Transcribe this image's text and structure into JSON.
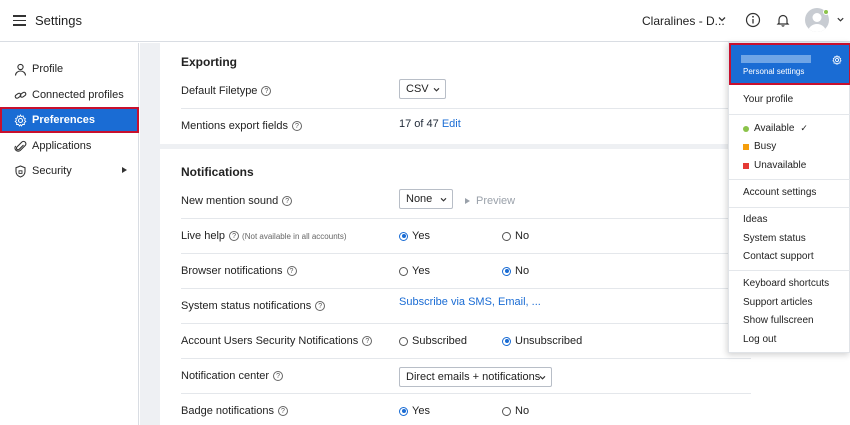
{
  "header": {
    "app_title": "Settings",
    "account_name": "Claralines - D..."
  },
  "sidebar": {
    "items": [
      {
        "label": "Profile",
        "icon": "person-icon"
      },
      {
        "label": "Connected profiles",
        "icon": "link-icon"
      },
      {
        "label": "Preferences",
        "icon": "gear-icon",
        "active": true
      },
      {
        "label": "Applications",
        "icon": "paperclip-icon"
      },
      {
        "label": "Security",
        "icon": "shield-icon",
        "has_submenu": true
      }
    ]
  },
  "exporting": {
    "title": "Exporting",
    "default_filetype_label": "Default Filetype",
    "default_filetype_value": "CSV",
    "mentions_export_label": "Mentions export fields",
    "mentions_export_count": "17 of 47",
    "mentions_export_edit": "Edit"
  },
  "notifications": {
    "title": "Notifications",
    "new_mention_sound_label": "New mention sound",
    "new_mention_sound_value": "None",
    "preview_label": "Preview",
    "live_help_label": "Live help",
    "live_help_note": "(Not available in all accounts)",
    "browser_notifications_label": "Browser notifications",
    "system_status_label": "System status notifications",
    "system_status_link": "Subscribe via SMS, Email, ...",
    "security_notifications_label": "Account Users Security Notifications",
    "subscribed_label": "Subscribed",
    "unsubscribed_label": "Unsubscribed",
    "notification_center_label": "Notification center",
    "notification_center_value": "Direct emails + notifications",
    "badge_notifications_label": "Badge notifications",
    "yes_label": "Yes",
    "no_label": "No"
  },
  "menu": {
    "personal_settings": "Personal settings",
    "your_profile": "Your profile",
    "available": "Available",
    "busy": "Busy",
    "unavailable": "Unavailable",
    "account_settings": "Account settings",
    "ideas": "Ideas",
    "system_status": "System status",
    "contact_support": "Contact support",
    "keyboard_shortcuts": "Keyboard shortcuts",
    "support_articles": "Support articles",
    "show_fullscreen": "Show fullscreen",
    "log_out": "Log out"
  },
  "colors": {
    "accent": "#1a6cd4",
    "highlight_border": "#c8102e",
    "available": "#8bc34a",
    "busy": "#f59e0b",
    "unavailable": "#e53935"
  }
}
